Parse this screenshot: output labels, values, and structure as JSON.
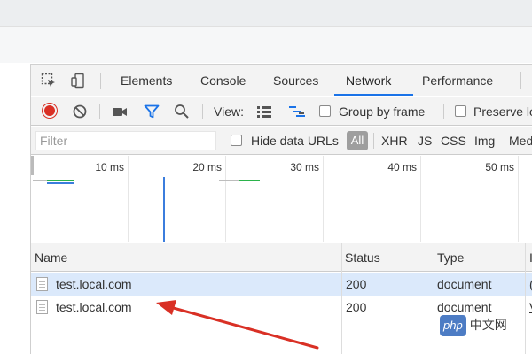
{
  "tabs": [
    "Elements",
    "Console",
    "Sources",
    "Network",
    "Performance"
  ],
  "active_tab": "Network",
  "toolbar": {
    "view_label": "View:",
    "group_by_frame_label": "Group by frame",
    "preserve_log_label": "Preserve lo"
  },
  "filterbar": {
    "filter_placeholder": "Filter",
    "hide_data_urls_label": "Hide data URLs",
    "types": [
      "All",
      "XHR",
      "JS",
      "CSS",
      "Img",
      "Med"
    ]
  },
  "overview": {
    "ticks": [
      "10 ms",
      "20 ms",
      "30 ms",
      "40 ms",
      "50 ms"
    ]
  },
  "table": {
    "columns": [
      "Name",
      "Status",
      "Type",
      "I"
    ],
    "rows": [
      {
        "name": "test.local.com",
        "status": "200",
        "type": "document",
        "initiator": "("
      },
      {
        "name": "test.local.com",
        "status": "200",
        "type": "document",
        "initiator": "V"
      }
    ]
  },
  "watermark": {
    "badge": "php",
    "text": "中文网"
  },
  "colors": {
    "record": "#d93025",
    "accent": "#1a73e8",
    "selected_row": "#dbe9fb",
    "arrow": "#d93025"
  }
}
